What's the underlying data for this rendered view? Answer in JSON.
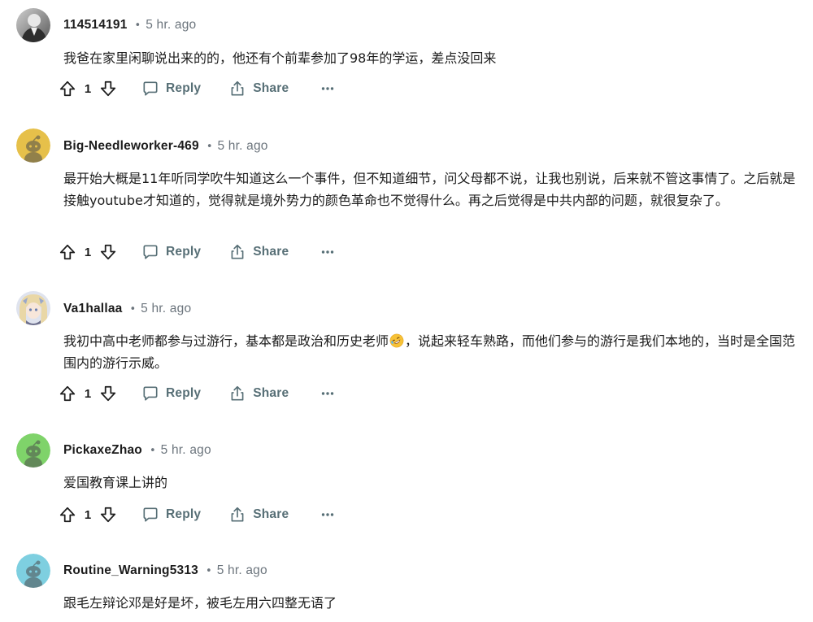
{
  "comments": [
    {
      "username": "114514191",
      "time": "5 hr. ago",
      "body": "我爸在家里闲聊说出来的的，他还有个前辈参加了98年的学运，差点没回来",
      "votes": "1",
      "reply_label": "Reply",
      "share_label": "Share",
      "avatar": "photo-avatar"
    },
    {
      "username": "Big-Needleworker-469",
      "time": "5 hr. ago",
      "body": "最开始大概是11年听同学吹牛知道这么一个事件，但不知道细节，问父母都不说，让我也别说，后来就不管这事情了。之后就是接触youtube才知道的，觉得就是境外势力的颜色革命也不觉得什么。再之后觉得是中共内部的问题，就很复杂了。",
      "votes": "1",
      "reply_label": "Reply",
      "share_label": "Share",
      "avatar": "snoo-avatar",
      "avatar_color": "#e6c04a"
    },
    {
      "username": "Va1hallaa",
      "time": "5 hr. ago",
      "body_before_emoji": "我初中高中老师都参与过游行，基本都是政治和历史老师",
      "emoji": "rolling-on-floor-laughing-emoji",
      "body_after_emoji": "，说起来轻车熟路，而他们参与的游行是我们本地的，当时是全国范围内的游行示威。",
      "votes": "1",
      "reply_label": "Reply",
      "share_label": "Share",
      "avatar": "anime-avatar"
    },
    {
      "username": "PickaxeZhao",
      "time": "5 hr. ago",
      "body": "爱国教育课上讲的",
      "votes": "1",
      "reply_label": "Reply",
      "share_label": "Share",
      "avatar": "snoo-avatar",
      "avatar_color": "#7fd36a"
    },
    {
      "username": "Routine_Warning5313",
      "time": "5 hr. ago",
      "body": "跟毛左辩论邓是好是坏，被毛左用六四整无语了",
      "avatar": "snoo-avatar",
      "avatar_color": "#7ecfe0"
    }
  ],
  "colors": {
    "text": "#1c1c1c",
    "meta": "#6c757d",
    "action": "#576f76"
  },
  "icons": [
    "upvote-icon",
    "downvote-icon",
    "reply-icon",
    "share-icon",
    "more-icon"
  ]
}
